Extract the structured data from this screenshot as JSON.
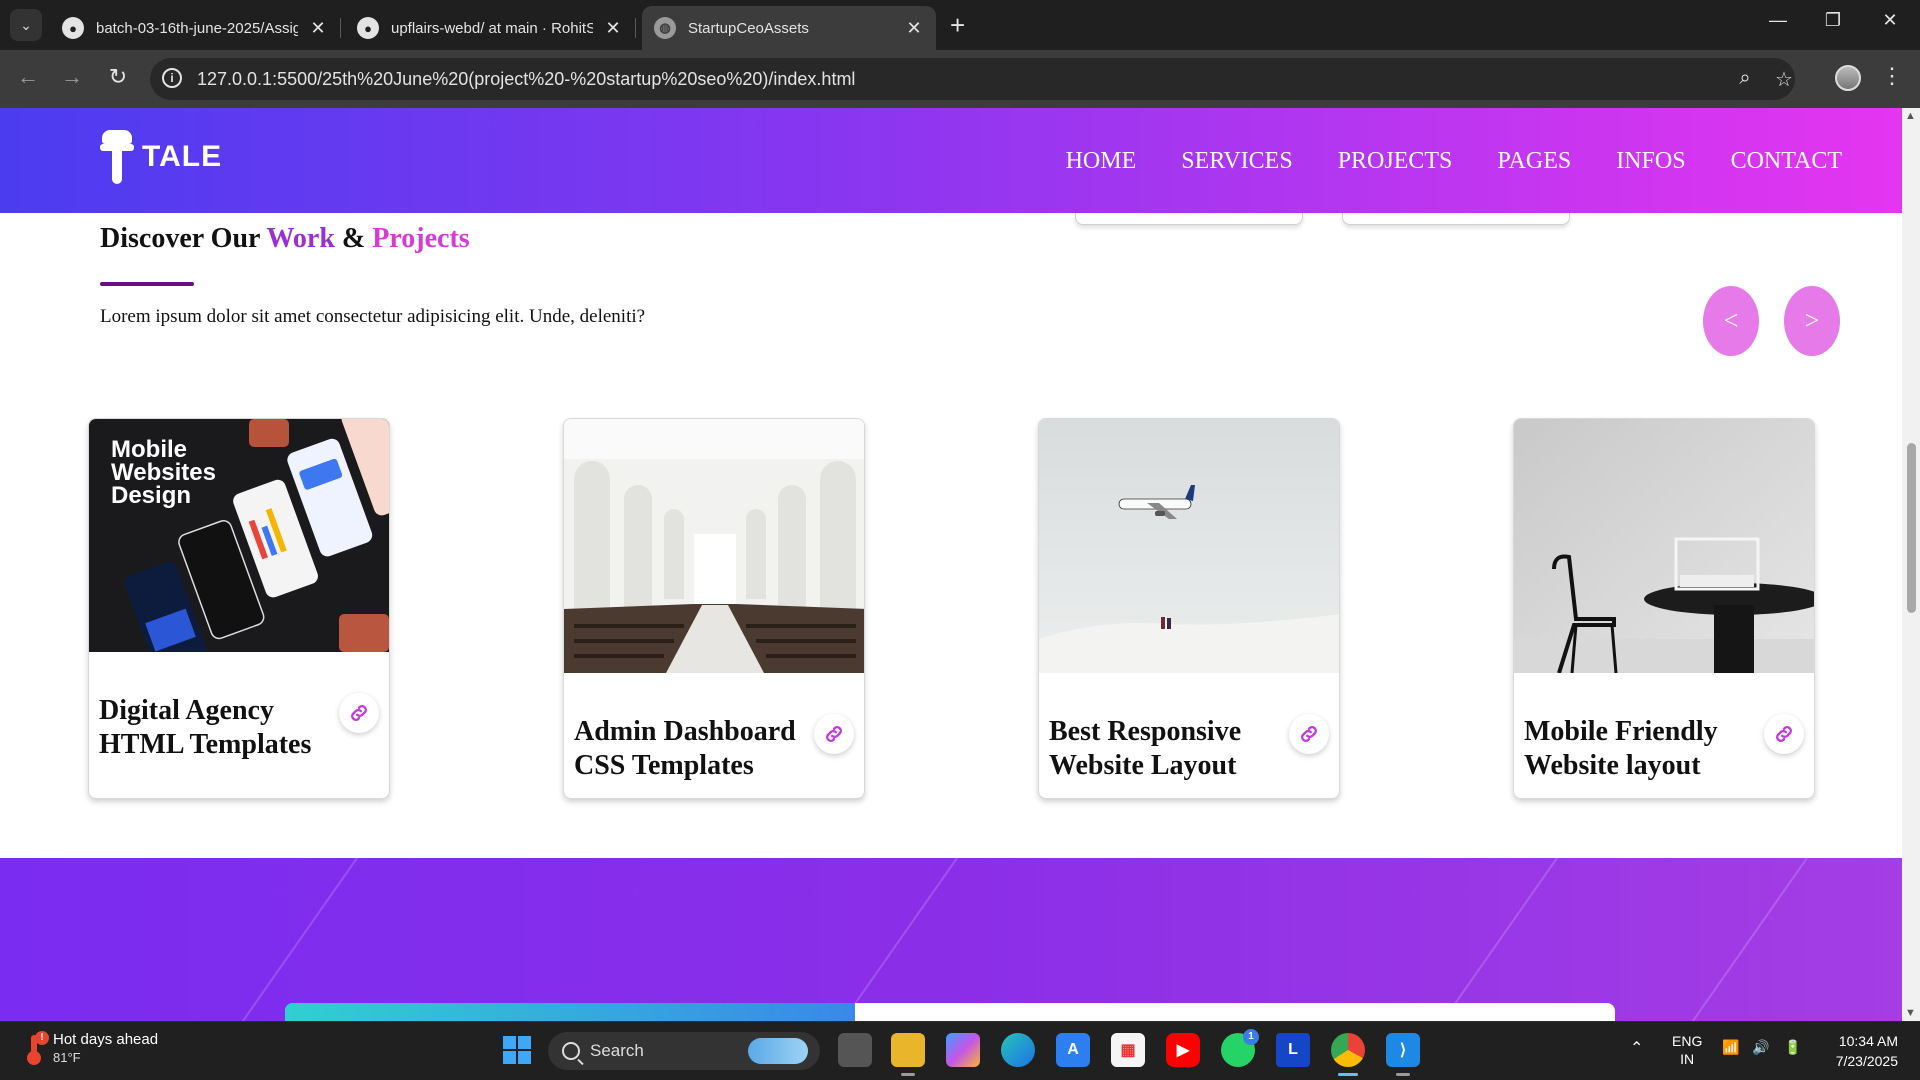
{
  "browser": {
    "tabs": [
      {
        "title": "batch-03-16th-june-2025/Assig",
        "icon": "github-icon",
        "active": false
      },
      {
        "title": "upflairs-webd/ at main · RohitS",
        "icon": "github-icon",
        "active": false
      },
      {
        "title": "StartupCeoAssets",
        "icon": "globe-icon",
        "active": true
      }
    ],
    "url": "127.0.0.1:5500/25th%20June%20(project%20-%20startup%20seo%20)/index.html"
  },
  "site": {
    "logo_text": "TALE",
    "nav": [
      "HOME",
      "SERVICES",
      "PROJECTS",
      "PAGES",
      "INFOS",
      "CONTACT"
    ],
    "section": {
      "title_prefix": "Discover Our ",
      "title_work": "Work",
      "title_amp": " & ",
      "title_projects": "Projects",
      "description": "Lorem ipsum dolor sit amet consectetur adipisicing elit. Unde, deleniti?",
      "prev_label": "<",
      "next_label": ">"
    },
    "cards": [
      {
        "title": "Digital Agency HTML Templates",
        "image": "mobile-websites-design",
        "image_text": [
          "Mobile",
          "Websites",
          "Design"
        ]
      },
      {
        "title": "Admin Dashboard CSS Templates",
        "image": "white-church-interior"
      },
      {
        "title": "Best Responsive Website Layout",
        "image": "airplane-over-snow"
      },
      {
        "title": "Mobile Friendly Website layout",
        "image": "black-table-chair"
      }
    ],
    "colors": {
      "accent_work": "#9b2fd6",
      "accent_projects": "#d83ad8",
      "button": "#e57ae8"
    }
  },
  "taskbar": {
    "weather_title": "Hot days ahead",
    "weather_temp": "81°F",
    "search_placeholder": "Search",
    "lang_top": "ENG",
    "lang_bottom": "IN",
    "time": "10:34 AM",
    "date": "7/23/2025",
    "whatsapp_badge": "1"
  }
}
